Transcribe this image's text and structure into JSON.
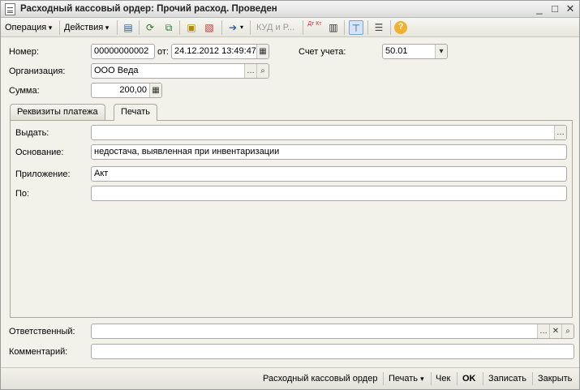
{
  "window": {
    "title": "Расходный кассовый ордер: Прочий расход. Проведен",
    "controls": [
      "_",
      "□",
      "✕"
    ]
  },
  "toolbar": {
    "operation": "Операция",
    "actions": "Действия",
    "kudir": "КУД и Р...",
    "dt_kt": "Дт Кт",
    "help": "?"
  },
  "form": {
    "number_label": "Номер:",
    "number_value": "00000000002",
    "date_label": "от:",
    "date_value": "24.12.2012 13:49:47",
    "account_label": "Счет учета:",
    "account_value": "50.01",
    "org_label": "Организация:",
    "org_value": "ООО Веда",
    "sum_label": "Сумма:",
    "sum_value": "200,00",
    "tabs": [
      "Реквизиты платежа",
      "Печать"
    ],
    "print": {
      "issue_label": "Выдать:",
      "issue_value": "",
      "basis_label": "Основание:",
      "basis_value": "недостача, выявленная при инвентаризации",
      "attachment_label": "Приложение:",
      "attachment_value": "Акт",
      "by_label": "По:",
      "by_value": ""
    },
    "responsible_label": "Ответственный:",
    "responsible_value": "",
    "comment_label": "Комментарий:",
    "comment_value": ""
  },
  "bottom": {
    "print_form": "Расходный кассовый ордер",
    "print": "Печать",
    "check": "Чек",
    "ok": "OK",
    "save": "Записать",
    "close": "Закрыть"
  }
}
